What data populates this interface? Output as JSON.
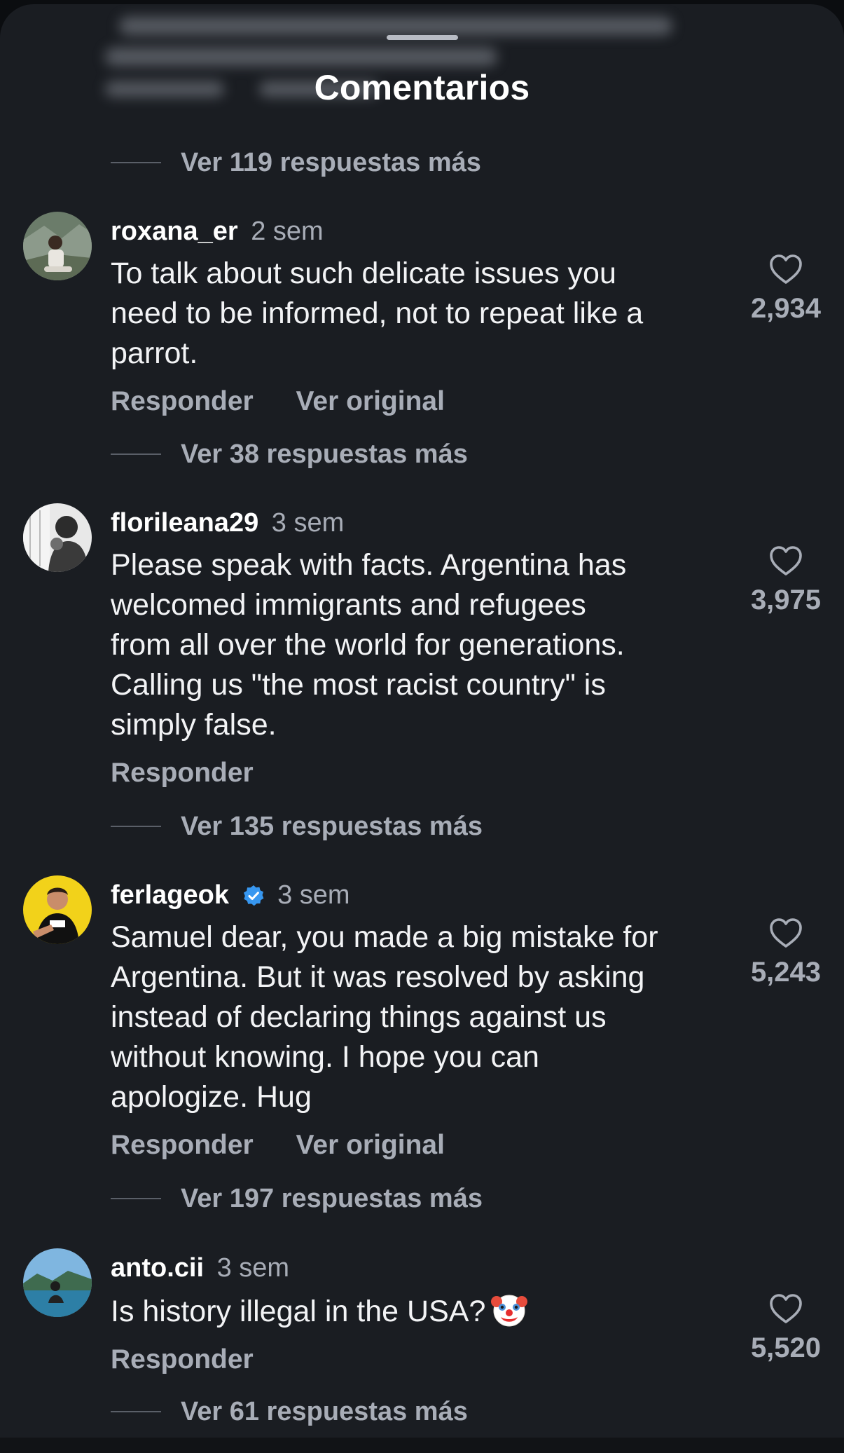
{
  "sheet": {
    "title": "Comentarios"
  },
  "top_thread": {
    "more_replies": "Ver 119 respuestas más"
  },
  "comments": [
    {
      "username": "roxana_er",
      "verified": false,
      "time": "2 sem",
      "lines": [
        "To talk about such delicate issues you",
        "need to be informed, not to repeat like a",
        "parrot."
      ],
      "reply": "Responder",
      "see_original": "Ver original",
      "likes": "2,934",
      "more_replies": "Ver 38 respuestas más"
    },
    {
      "username": "florileana29",
      "verified": false,
      "time": "3 sem",
      "lines": [
        "Please speak with facts. Argentina has",
        "welcomed immigrants and refugees",
        "from all over the world for generations.",
        "Calling us \"the most racist country\" is",
        "simply false."
      ],
      "reply": "Responder",
      "likes": "3,975",
      "more_replies": "Ver 135 respuestas más"
    },
    {
      "username": "ferlageok",
      "verified": true,
      "time": "3 sem",
      "lines": [
        "Samuel dear, you made a big mistake for",
        "Argentina. But it was resolved by asking",
        "instead of declaring things against us",
        "without knowing. I hope you can",
        "apologize. Hug"
      ],
      "reply": "Responder",
      "see_original": "Ver original",
      "likes": "5,243",
      "more_replies": "Ver 197 respuestas más"
    },
    {
      "username": "anto.cii",
      "verified": false,
      "time": "3 sem",
      "lines": [
        "Is history illegal in the USA?"
      ],
      "emoji": "clown-face",
      "reply": "Responder",
      "likes": "5,520",
      "more_replies": "Ver 61 respuestas más"
    }
  ],
  "icons": {
    "like": "heart-outline-icon",
    "verified": "verified-badge-icon",
    "drag": "grabber-handle"
  },
  "colors": {
    "background": "#1a1d22",
    "primary_text": "#ffffff",
    "secondary_text": "#a8adb7",
    "verified_blue": "#3797f0"
  }
}
